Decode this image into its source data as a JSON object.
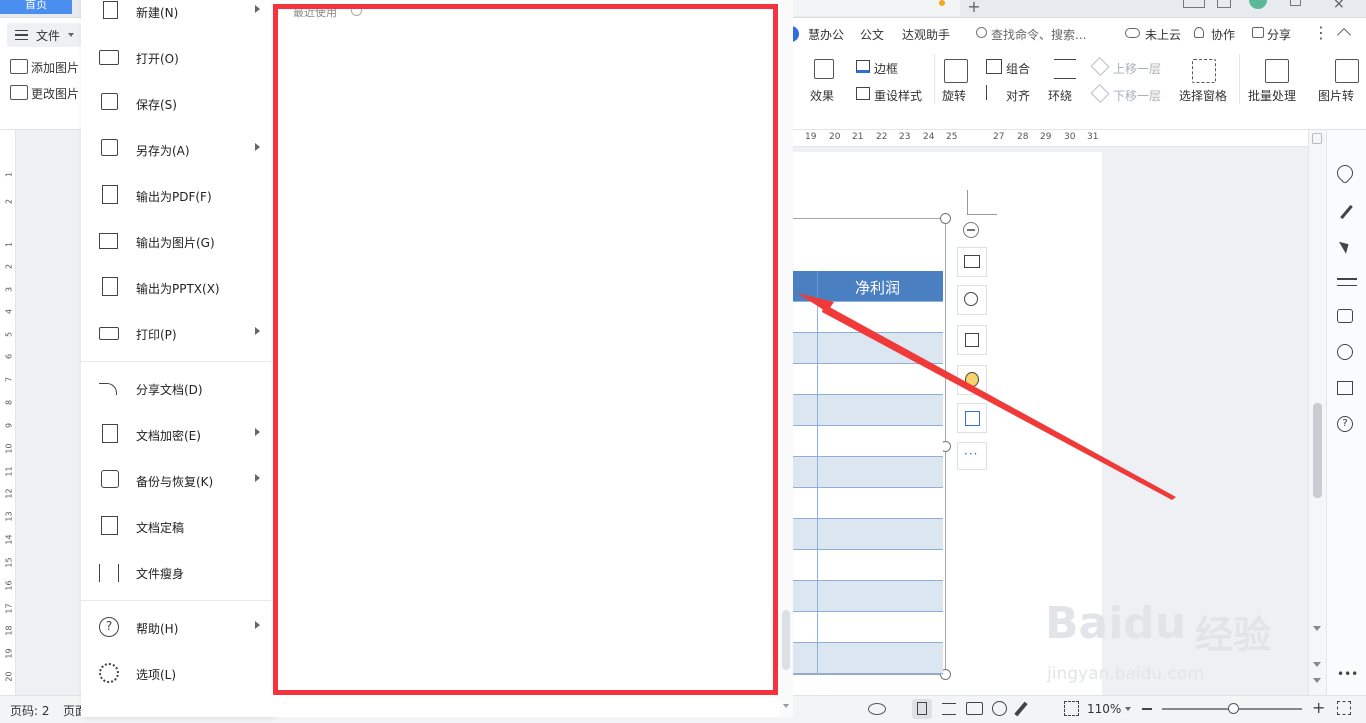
{
  "titlebar": {
    "home_tab": "首页"
  },
  "ribbon": {
    "file_menu_label": "文件",
    "left_buttons": [
      "添加图片",
      "更改图片"
    ],
    "tabs": [
      "慧办公",
      "公文",
      "达观助手"
    ],
    "search_placeholder": "查找命令、搜索...",
    "cloud_status": "未上云",
    "collab_label": "协作",
    "share_label": "分享",
    "tools": {
      "effects": "效果",
      "border": "边框",
      "reset_style": "重设样式",
      "rotate": "旋转",
      "group": "组合",
      "align": "对齐",
      "wrap": "环绕",
      "bring_forward": "上移一层",
      "send_backward": "下移一层",
      "selection_pane": "选择窗格",
      "batch_process": "批量处理",
      "picture_convert": "图片转"
    }
  },
  "ruler": {
    "h_ticks": [
      "19",
      "20",
      "21",
      "22",
      "23",
      "24",
      "25",
      "27",
      "28",
      "29",
      "30",
      "31"
    ],
    "v_ticks": [
      "1",
      "2",
      "1",
      "2",
      "3",
      "4",
      "5",
      "6",
      "7",
      "8",
      "9",
      "10",
      "11",
      "12",
      "13",
      "14",
      "15",
      "16",
      "17",
      "18",
      "19",
      "20"
    ]
  },
  "file_menu": {
    "items": [
      {
        "label": "新建(N)",
        "icon": "new-doc-icon",
        "submenu": true
      },
      {
        "label": "打开(O)",
        "icon": "folder-open-icon",
        "submenu": false
      },
      {
        "label": "保存(S)",
        "icon": "save-icon",
        "submenu": false
      },
      {
        "label": "另存为(A)",
        "icon": "save-as-icon",
        "submenu": true
      },
      {
        "label": "输出为PDF(F)",
        "icon": "export-pdf-icon",
        "submenu": false
      },
      {
        "label": "输出为图片(G)",
        "icon": "export-image-icon",
        "submenu": false
      },
      {
        "label": "输出为PPTX(X)",
        "icon": "export-pptx-icon",
        "submenu": false
      },
      {
        "label": "打印(P)",
        "icon": "print-icon",
        "submenu": true
      },
      {
        "label": "分享文档(D)",
        "icon": "share-icon",
        "submenu": false
      },
      {
        "label": "文档加密(E)",
        "icon": "encrypt-icon",
        "submenu": true
      },
      {
        "label": "备份与恢复(K)",
        "icon": "backup-icon",
        "submenu": true
      },
      {
        "label": "文档定稿",
        "icon": "finalize-icon",
        "submenu": false
      },
      {
        "label": "文件瘦身",
        "icon": "slim-icon",
        "submenu": false
      },
      {
        "label": "帮助(H)",
        "icon": "help-icon",
        "submenu": true
      },
      {
        "label": "选项(L)",
        "icon": "gear-icon",
        "submenu": false
      }
    ]
  },
  "recent": {
    "title": "最近使用"
  },
  "table": {
    "header": "净利润"
  },
  "statusbar": {
    "page_label": "页码: 2",
    "page_short": "页面",
    "zoom": "110%"
  },
  "watermark": {
    "brand": "Baidu",
    "cn": "经验",
    "url": "jingyan.baidu.com"
  },
  "colors": {
    "highlight": "#f5333f",
    "table_header": "#4a7fc1",
    "accent": "#4a8ef0"
  }
}
